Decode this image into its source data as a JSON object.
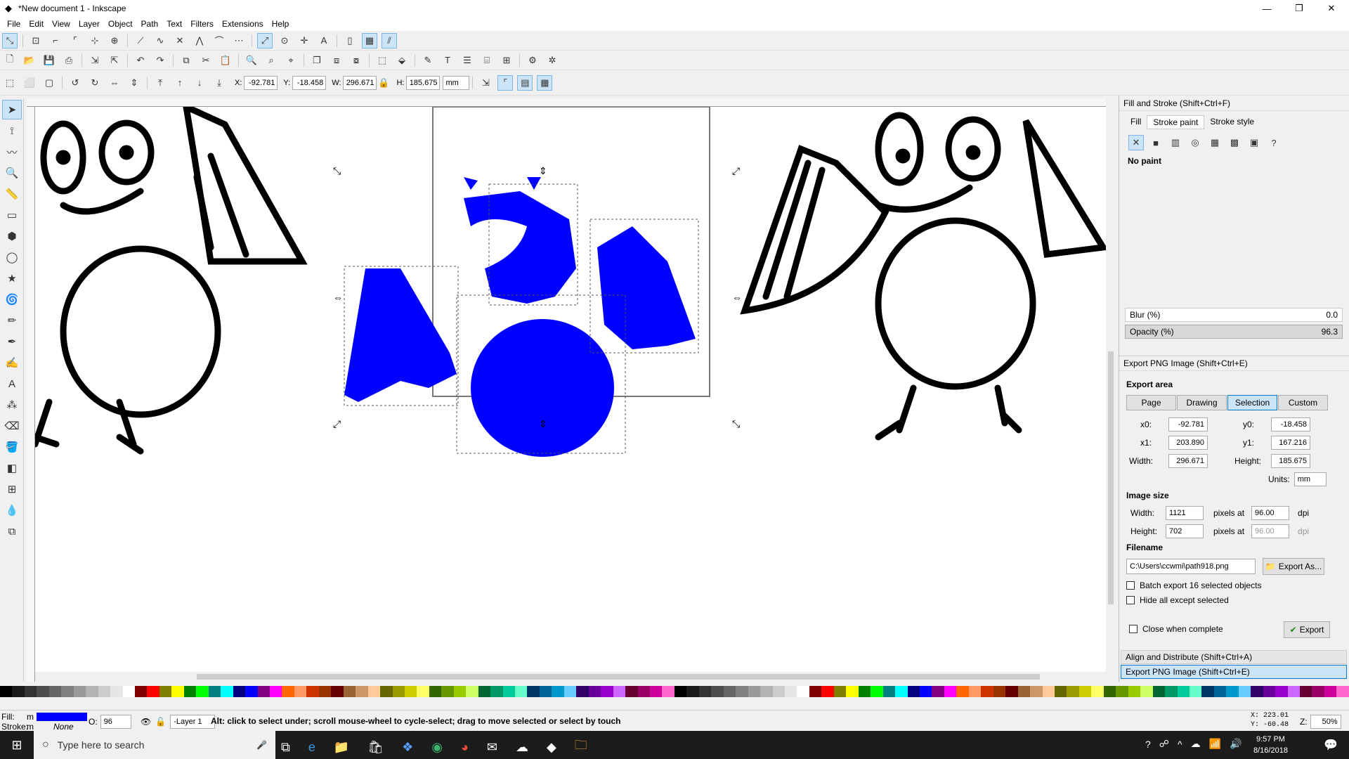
{
  "window": {
    "title": "*New document 1 - Inkscape"
  },
  "menu": [
    "File",
    "Edit",
    "View",
    "Layer",
    "Object",
    "Path",
    "Text",
    "Filters",
    "Extensions",
    "Help"
  ],
  "select_toolbar": {
    "x_label": "X:",
    "x": "-92.781",
    "y_label": "Y:",
    "y": "-18.458",
    "w_label": "W:",
    "w": "296.671",
    "h_label": "H:",
    "h": "185.675",
    "unit": "mm"
  },
  "fill_stroke": {
    "title": "Fill and Stroke (Shift+Ctrl+F)",
    "tabs": [
      "Fill",
      "Stroke paint",
      "Stroke style"
    ],
    "paint_state": "No paint",
    "blur_label": "Blur (%)",
    "blur": "0.0",
    "opacity_label": "Opacity (%)",
    "opacity": "96.3"
  },
  "export": {
    "title": "Export PNG Image (Shift+Ctrl+E)",
    "area_label": "Export area",
    "area_buttons": [
      "Page",
      "Drawing",
      "Selection",
      "Custom"
    ],
    "x0_label": "x0:",
    "x0": "-92.781",
    "y0_label": "y0:",
    "y0": "-18.458",
    "x1_label": "x1:",
    "x1": "203.890",
    "y1_label": "y1:",
    "y1": "167.216",
    "width_label": "Width:",
    "width": "296.671",
    "height_label": "Height:",
    "height": "185.675",
    "units_label": "Units:",
    "units": "mm",
    "image_size_label": "Image size",
    "img_width_label": "Width:",
    "img_width": "1121",
    "img_height_label": "Height:",
    "img_height": "702",
    "pixels_at": "pixels at",
    "dpi": "96.00",
    "dpi2": "96.00",
    "dpi_label": "dpi",
    "filename_label": "Filename",
    "filename": "C:\\Users\\ccwmi\\path918.png",
    "export_as": "Export As...",
    "batch": "Batch export 16 selected objects",
    "hide_all": "Hide all except selected",
    "close_when": "Close when complete",
    "export_btn": "Export"
  },
  "docked": [
    "Align and Distribute (Shift+Ctrl+A)",
    "Export PNG Image (Shift+Ctrl+E)"
  ],
  "status": {
    "fill_label": "Fill:",
    "fill_m": "m",
    "stroke_label": "Stroke:",
    "stroke_m": "m",
    "stroke_val": "None",
    "o_label": "O:",
    "o": "96",
    "layer": "-Layer 1",
    "message": "Alt: click to select under; scroll mouse-wheel to cycle-select; drag to move selected or select by touch",
    "coords_x": "X: 223.01",
    "coords_y": "Y: -60.48",
    "zoom_label": "Z:",
    "zoom": "50%"
  },
  "taskbar": {
    "search": "Type here to search",
    "time": "9:57 PM",
    "date": "8/16/2018"
  },
  "colors": {
    "accent": "#0000ff"
  }
}
